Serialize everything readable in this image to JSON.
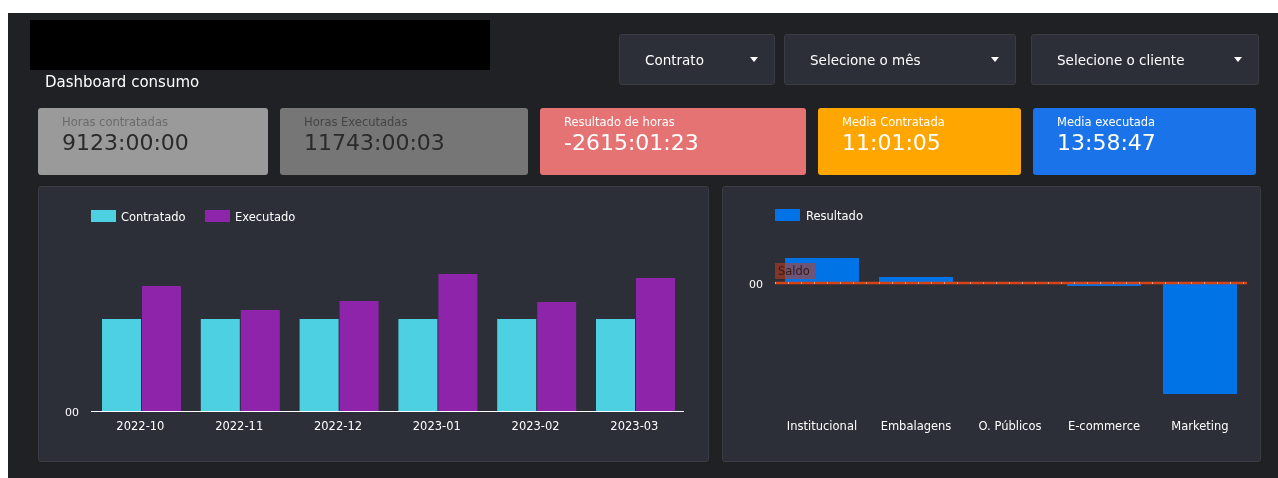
{
  "header": {
    "title": "Dashboard consumo"
  },
  "filters": [
    {
      "label": "Contrato"
    },
    {
      "label": "Selecione o mês"
    },
    {
      "label": "Selecione o cliente"
    }
  ],
  "kpis": [
    {
      "label": "Horas contratadas",
      "value": "9123:00:00",
      "color": "#9a9a9a"
    },
    {
      "label": "Horas Executadas",
      "value": "11743:00:03",
      "color": "#767676"
    },
    {
      "label": "Resultado de horas",
      "value": "-2615:01:23",
      "color": "#e57373"
    },
    {
      "label": "Media Contratada",
      "value": "11:01:05",
      "color": "#ffa600"
    },
    {
      "label": "Media executada",
      "value": "13:58:47",
      "color": "#1a73e8"
    }
  ],
  "monthly_chart": {
    "legend": [
      {
        "label": "Contratado",
        "color": "#4dd0e1"
      },
      {
        "label": "Executado",
        "color": "#8e24aa"
      }
    ],
    "y_tick": "00",
    "categories": [
      "2022-10",
      "2022-11",
      "2022-12",
      "2023-01",
      "2023-02",
      "2023-03"
    ]
  },
  "area_chart": {
    "legend": [
      {
        "label": "Resultado",
        "color": "#0073e6"
      }
    ],
    "y_tick": "00",
    "reference_label": "Saldo",
    "categories": [
      "Institucional",
      "Embalagens",
      "O. Públicos",
      "E-commerce",
      "Marketing"
    ]
  }
}
